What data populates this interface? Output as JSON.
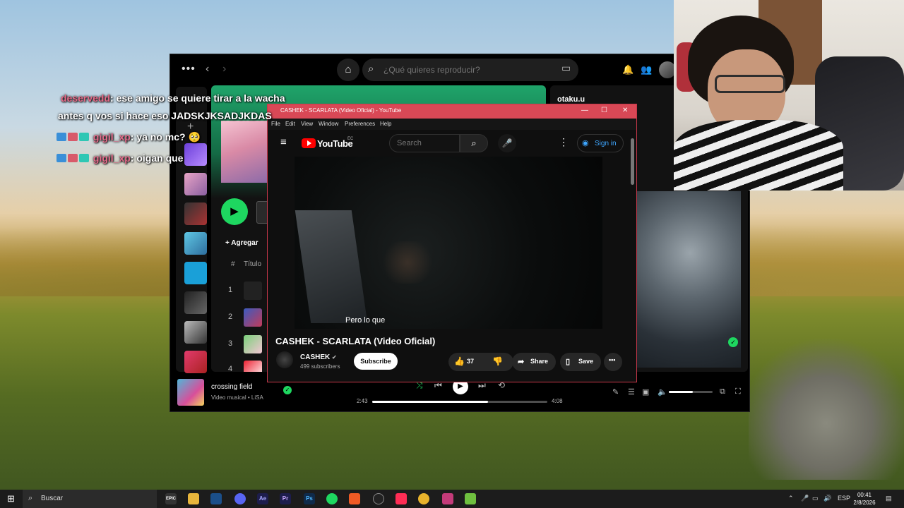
{
  "spotify": {
    "search_placeholder": "¿Qué quieres reproducir?",
    "add_label": "Agregar",
    "title_column": "Título",
    "hash_column": "#",
    "track_numbers": [
      "1",
      "2",
      "3",
      "4"
    ],
    "right_panel_title": "otaku.u",
    "now_playing": {
      "title": "crossing field",
      "subtitle": "Video musical • LiSA",
      "elapsed": "2:43",
      "duration": "4:08",
      "progress_fraction": 0.66,
      "volume_fraction": 0.55
    },
    "colors": {
      "accent": "#1ed760",
      "hero": "#1fa46a"
    }
  },
  "youtube": {
    "window_title": "CASHEK - SCARLATA (Video Oficial) - YouTube",
    "menu": [
      "File",
      "Edit",
      "View",
      "Window",
      "Preferences",
      "Help"
    ],
    "logo_text": "YouTube",
    "logo_region": "EC",
    "search_placeholder": "Search",
    "sign_in": "Sign in",
    "caption": "Pero lo que",
    "video_title": "CASHEK - SCARLATA (Video Oficial)",
    "channel_name": "CASHEK",
    "subscribers": "499 subscribers",
    "subscribe": "Subscribe",
    "likes": "37",
    "share": "Share",
    "save": "Save"
  },
  "chat": [
    {
      "user": "deservedd",
      "message": ": ese amigo se quiere tirar a la wacha"
    },
    {
      "user": "",
      "message": "antes q vos si hace eso JADSKJKSADJKDAS"
    },
    {
      "user": "gigil_xp",
      "message": ": ya no mc? 🥺"
    },
    {
      "user": "gigil_xp",
      "message": ": oigan que"
    }
  ],
  "taskbar": {
    "search_label": "Buscar",
    "apps": [
      "EPIC",
      "Files",
      "Steam",
      "Discord",
      "Ae",
      "Pr",
      "Ps",
      "Spotify",
      "Brave",
      "OBS",
      "TikTok",
      "Chrome",
      "App",
      "Minecraft"
    ],
    "language": "ESP",
    "time": "00:41",
    "date": "2/8/2026"
  }
}
